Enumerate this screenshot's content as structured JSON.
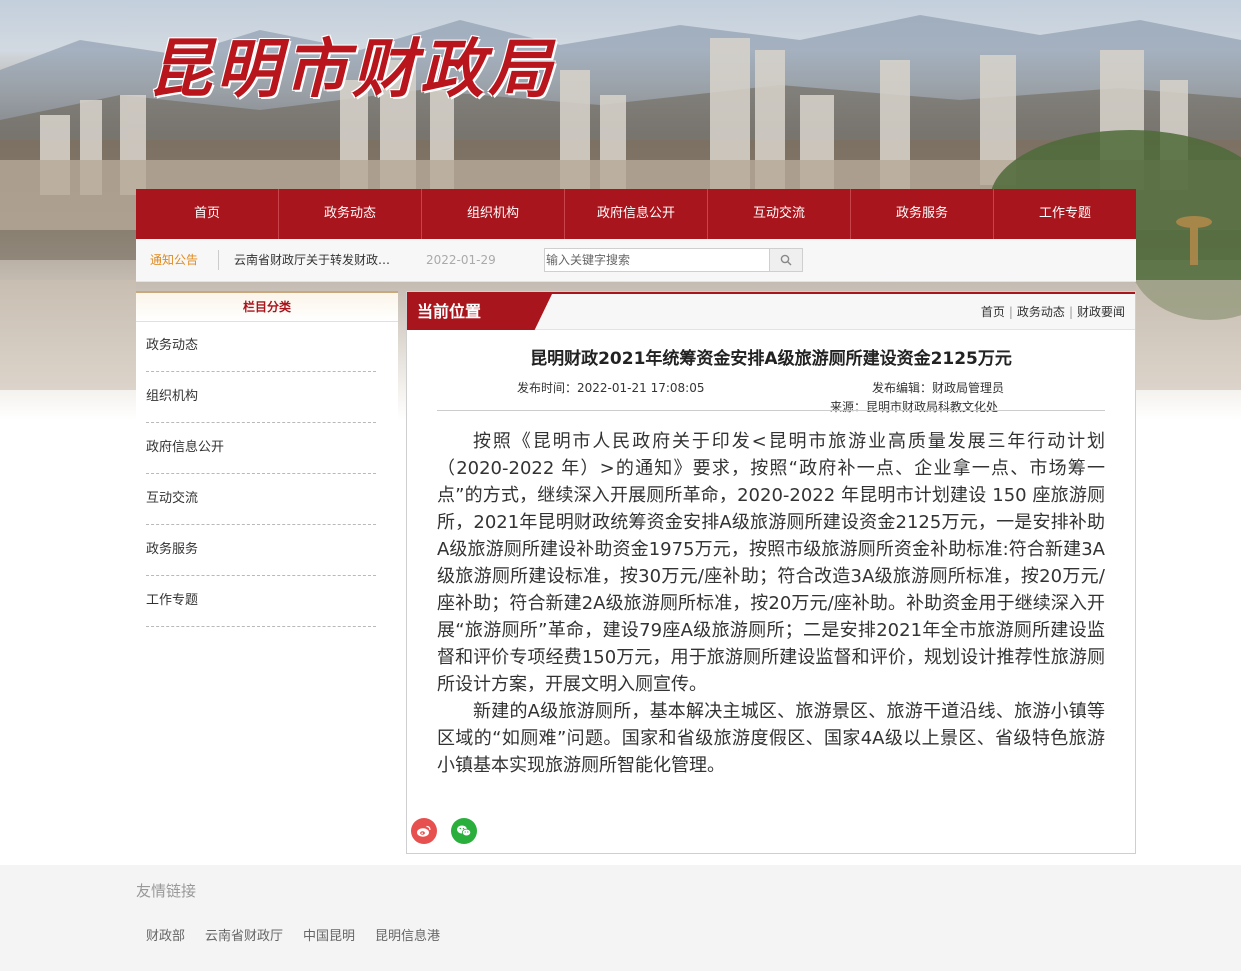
{
  "site": {
    "logo_text": "昆明市财政局",
    "brand_color": "#a8151c"
  },
  "nav": {
    "items": [
      "首页",
      "政务动态",
      "组织机构",
      "政府信息公开",
      "互动交流",
      "政务服务",
      "工作专题"
    ]
  },
  "notice": {
    "label": "通知公告",
    "text": "云南省财政厅关于转发财政…",
    "date": "2022-01-29",
    "search_placeholder": "输入关键字搜索",
    "search_icon": "search-icon"
  },
  "sidebar": {
    "title": "栏目分类",
    "items": [
      "政务动态",
      "组织机构",
      "政府信息公开",
      "互动交流",
      "政务服务",
      "工作专题"
    ]
  },
  "content": {
    "position_label": "当前位置",
    "breadcrumb": [
      "首页",
      "政务动态",
      "财政要闻"
    ],
    "title": "昆明财政2021年统筹资金安排A级旅游厕所建设资金2125万元",
    "publish_time_label": "发布时间：",
    "publish_time": "2022-01-21 17:08:05",
    "editor_label": "发布编辑：",
    "editor": "财政局管理员",
    "source_label": "来源：",
    "source": "昆明市财政局科教文化处",
    "paragraphs": [
      "按照《昆明市人民政府关于印发<昆明市旅游业高质量发展三年行动计划 （2020-2022 年）>的通知》要求，按照“政府补一点、企业拿一点、市场筹一点”的方式，继续深入开展厕所革命，2020-2022 年昆明市计划建设 150 座旅游厕所，2021年昆明财政统筹资金安排A级旅游厕所建设资金2125万元，一是安排补助A级旅游厕所建设补助资金1975万元，按照市级旅游厕所资金补助标准:符合新建3A级旅游厕所建设标准，按30万元/座补助；符合改造3A级旅游厕所标准，按20万元/座补助；符合新建2A级旅游厕所标准，按20万元/座补助。补助资金用于继续深入开展“旅游厕所”革命，建设79座A级旅游厕所；二是安排2021年全市旅游厕所建设监督和评价专项经费150万元，用于旅游厕所建设监督和评价，规划设计推荐性旅游厕所设计方案，开展文明入厕宣传。",
      "新建的A级旅游厕所，基本解决主城区、旅游景区、旅游干道沿线、旅游小镇等区域的“如厕难”问题。国家和省级旅游度假区、国家4A级以上景区、省级特色旅游小镇基本实现旅游厕所智能化管理。"
    ],
    "share": {
      "weibo_icon": "weibo-icon",
      "weibo_color": "#e6504f",
      "wechat_icon": "wechat-icon",
      "wechat_color": "#2aae3c"
    }
  },
  "footer": {
    "title": "友情链接",
    "links": [
      "财政部",
      "云南省财政厅",
      "中国昆明",
      "昆明信息港"
    ]
  }
}
